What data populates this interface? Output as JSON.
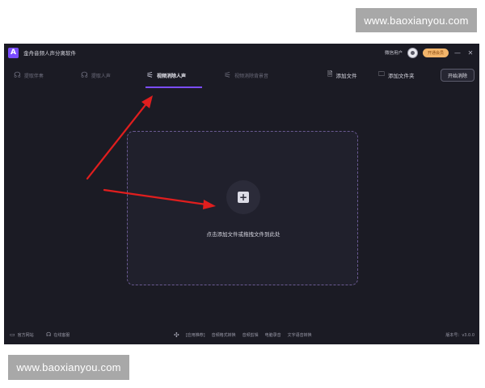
{
  "watermark": {
    "top": "www.baoxianyou.com",
    "bottom": "www.baoxianyou.com"
  },
  "titlebar": {
    "logo_letter": "A",
    "app_title": "金舟音频人声分离软件",
    "wechat_user": "微信用户",
    "vip_label": "开通会员",
    "minimize": "—",
    "close": "✕"
  },
  "tabs": [
    {
      "label": "提取伴奏",
      "icon": "headphones-icon",
      "glyph": "☊",
      "active": false
    },
    {
      "label": "提取人声",
      "icon": "headphones-icon",
      "glyph": "☊",
      "active": false
    },
    {
      "label": "视频消除人声",
      "icon": "video-mute-icon",
      "glyph": "⚟",
      "active": true
    },
    {
      "label": "视频消除背景音",
      "icon": "video-mute-icon",
      "glyph": "⚟",
      "active": false
    }
  ],
  "actions": {
    "add_file": "添加文件",
    "add_folder": "添加文件夹",
    "start": "开始消除"
  },
  "dropzone": {
    "plus": "+",
    "hint": "点击添加文件或拖拽文件到此处"
  },
  "footer": {
    "official_site": "官方网站",
    "online_support": "在线客服",
    "recommend_label": "[应用推荐]",
    "links": [
      "音频格式转换",
      "音频剪辑",
      "电脑录音",
      "文字语音转换"
    ],
    "version": "版本号：v3.0.0"
  },
  "colors": {
    "background": "#1b1b24",
    "accent": "#7c4dff",
    "arrow": "#e01e1e",
    "vip": "#f2b56b"
  }
}
